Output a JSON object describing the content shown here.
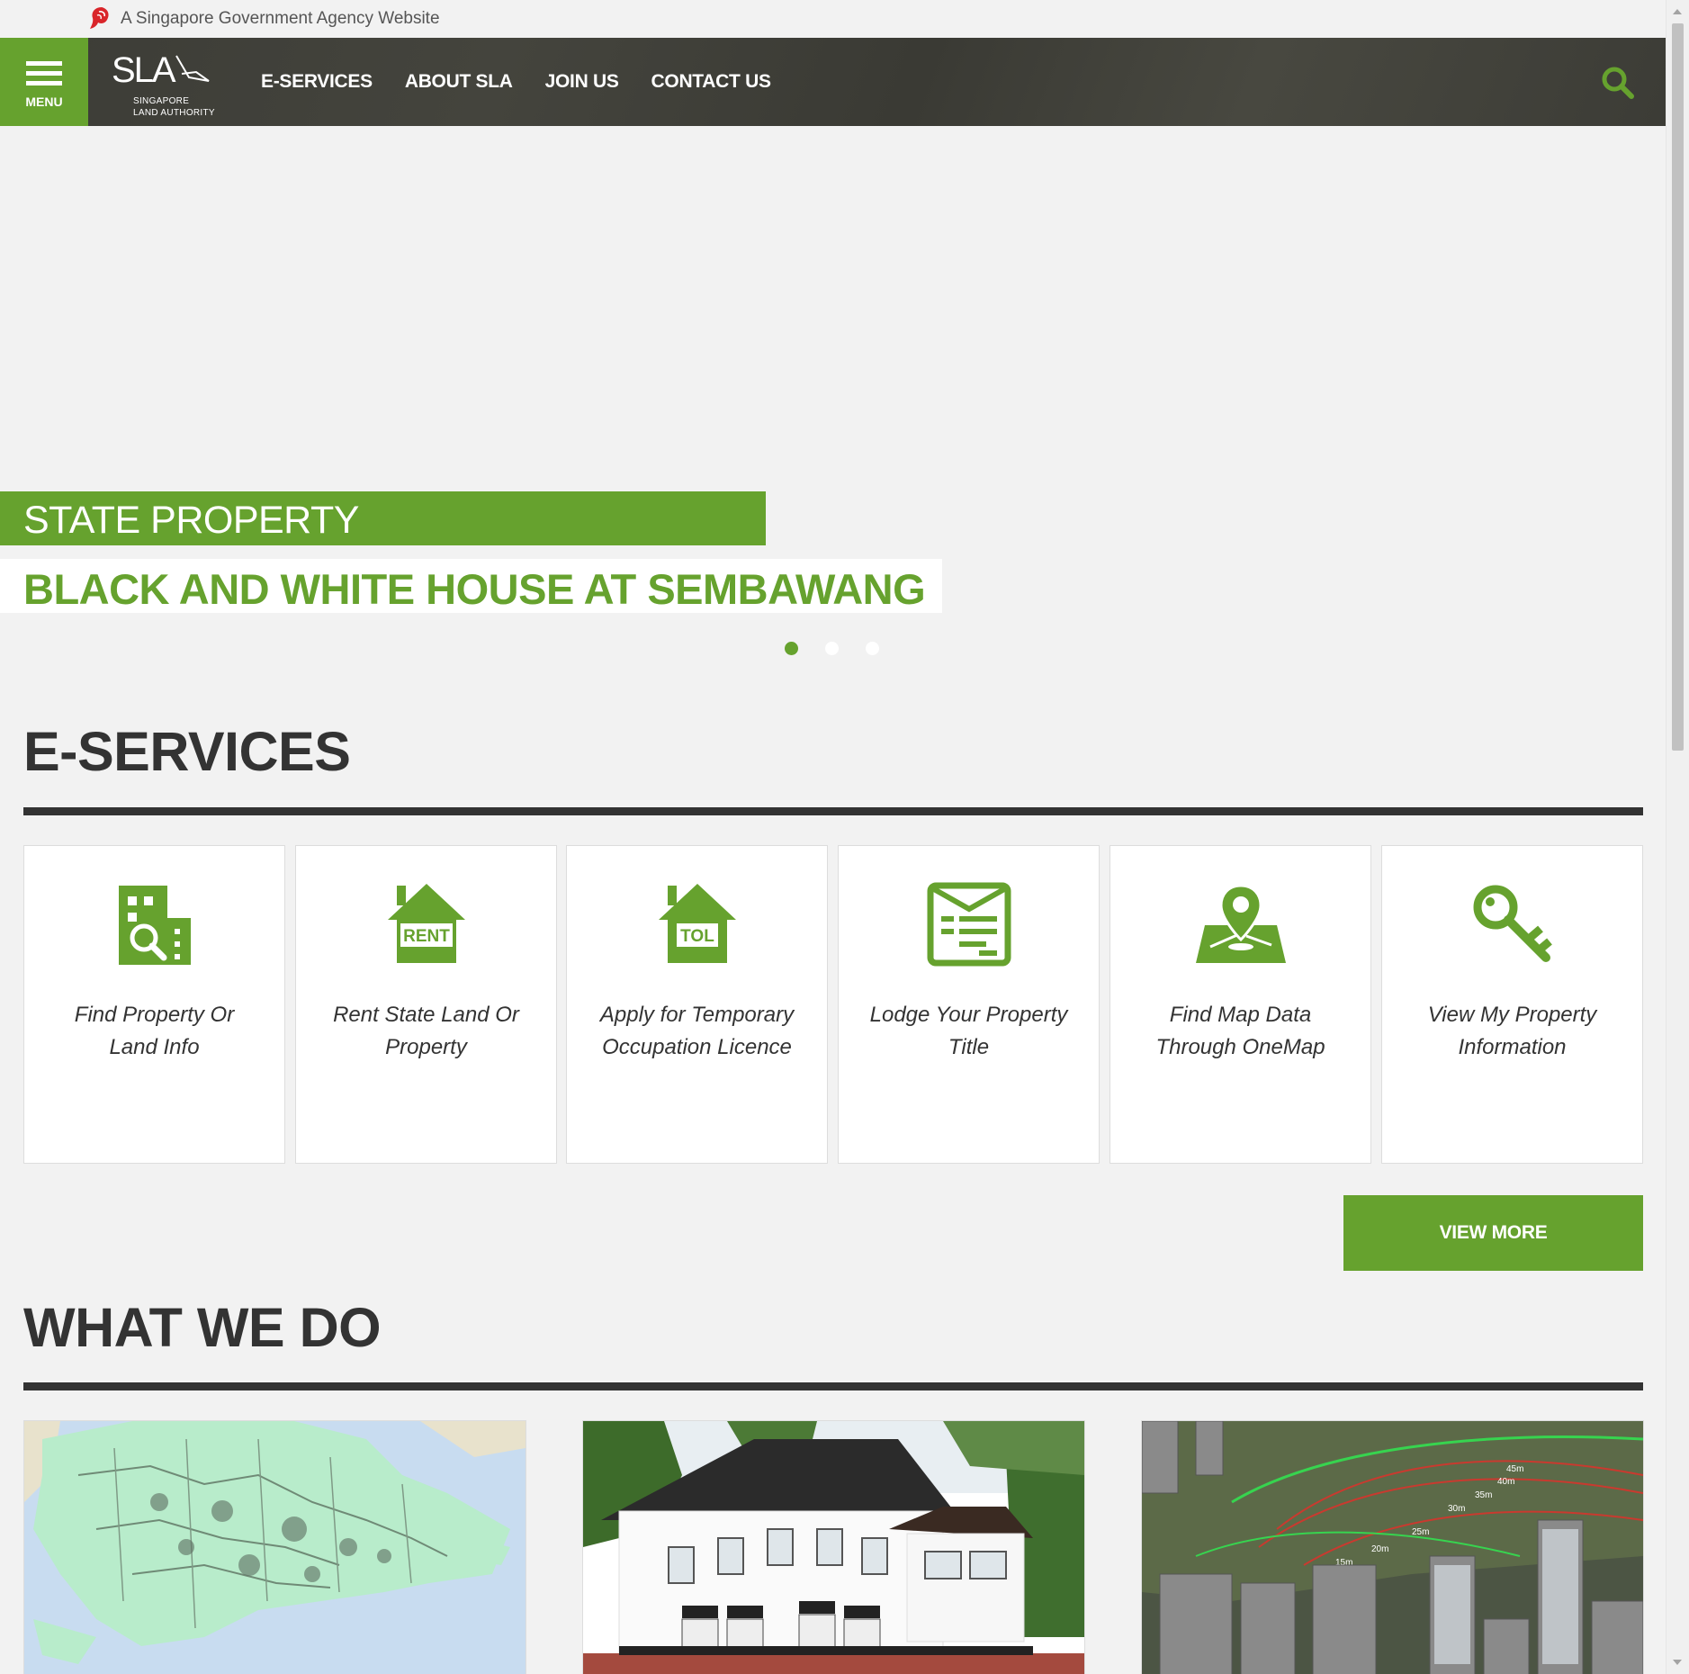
{
  "masthead": {
    "text": "A Singapore Government Agency Website"
  },
  "header": {
    "menu_label": "MENU",
    "logo": {
      "name": "SLA",
      "line1": "SINGAPORE",
      "line2": "LAND AUTHORITY"
    },
    "nav": [
      "E-SERVICES",
      "ABOUT SLA",
      "JOIN US",
      "CONTACT US"
    ]
  },
  "hero": {
    "category": "STATE PROPERTY",
    "title": "BLACK AND WHITE HOUSE AT SEMBAWANG",
    "slides": 3,
    "active_slide": 1
  },
  "eservices": {
    "title": "E-SERVICES",
    "items": [
      {
        "label": "Find Property Or Land Info",
        "icon": "building-search-icon"
      },
      {
        "label": "Rent State Land Or Property",
        "icon": "rent-house-icon",
        "badge": "RENT"
      },
      {
        "label": "Apply for Temporary Occupation Licence",
        "icon": "tol-house-icon",
        "badge": "TOL"
      },
      {
        "label": "Lodge Your Property Title",
        "icon": "document-envelope-icon"
      },
      {
        "label": "Find Map Data Through OneMap",
        "icon": "map-pin-icon"
      },
      {
        "label": "View My Property Information",
        "icon": "key-icon"
      }
    ],
    "view_more": "VIEW MORE"
  },
  "what_we_do": {
    "title": "WHAT WE DO",
    "map_labels": [
      "45m",
      "40m",
      "35m",
      "30m",
      "25m",
      "20m",
      "15m"
    ]
  },
  "colors": {
    "brand_green": "#66a22e",
    "header_dark": "#3c3c36",
    "text_dark": "#333333"
  }
}
